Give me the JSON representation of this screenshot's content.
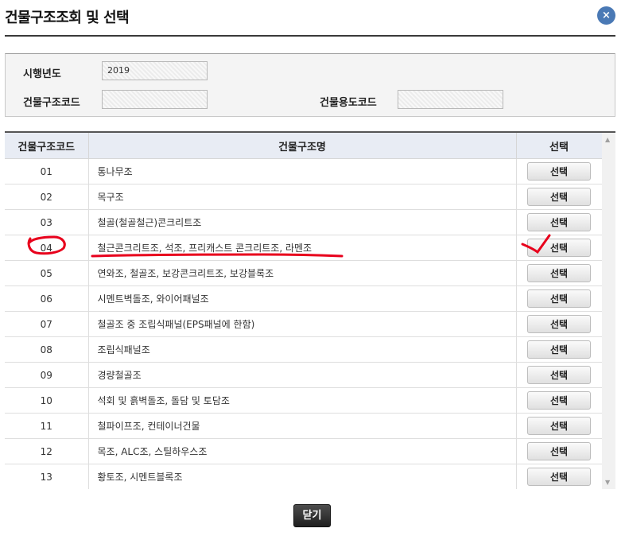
{
  "header": {
    "title": "건물구조조회 및 선택",
    "close_icon": "×"
  },
  "search": {
    "year_label": "시행년도",
    "year_value": "2019",
    "structure_code_label": "건물구조코드",
    "structure_code_value": "",
    "usage_code_label": "건물용도코드",
    "usage_code_value": ""
  },
  "table": {
    "columns": [
      "건물구조코드",
      "건물구조명",
      "선택"
    ],
    "select_label": "선택",
    "rows": [
      {
        "code": "01",
        "name": "통나무조"
      },
      {
        "code": "02",
        "name": "목구조"
      },
      {
        "code": "03",
        "name": "철골(철골철근)콘크리트조"
      },
      {
        "code": "04",
        "name": "철근콘크리트조, 석조, 프리캐스트 콘크리트조, 라멘조"
      },
      {
        "code": "05",
        "name": "연와조, 철골조, 보강콘크리트조, 보강블록조"
      },
      {
        "code": "06",
        "name": "시멘트벽돌조, 와이어패널조"
      },
      {
        "code": "07",
        "name": "철골조 중 조립식패널(EPS패널에 한함)"
      },
      {
        "code": "08",
        "name": "조립식패널조"
      },
      {
        "code": "09",
        "name": "경량철골조"
      },
      {
        "code": "10",
        "name": "석회 및 흙벽돌조, 돌담 및 토담조"
      },
      {
        "code": "11",
        "name": "철파이프조, 컨테이너건물"
      },
      {
        "code": "12",
        "name": "목조, ALC조, 스틸하우스조"
      },
      {
        "code": "13",
        "name": "황토조, 시멘트블록조"
      }
    ]
  },
  "footer": {
    "close_label": "닫기"
  },
  "annotation_color": "#e8001c"
}
